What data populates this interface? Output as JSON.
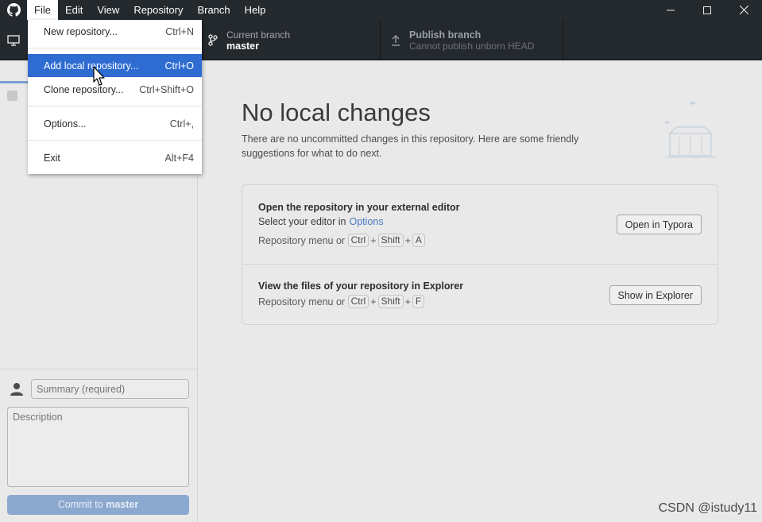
{
  "menubar": {
    "items": [
      "File",
      "Edit",
      "View",
      "Repository",
      "Branch",
      "Help"
    ]
  },
  "toolbar": {
    "current_branch_label": "Current branch",
    "current_branch_value": "master",
    "publish_label": "Publish branch",
    "publish_desc": "Cannot publish unborn HEAD"
  },
  "file_menu": {
    "items": [
      {
        "label": "New repository...",
        "accel": "Ctrl+N"
      },
      {
        "label": "Add local repository...",
        "accel": "Ctrl+O"
      },
      {
        "label": "Clone repository...",
        "accel": "Ctrl+Shift+O"
      },
      {
        "label": "Options...",
        "accel": "Ctrl+,"
      },
      {
        "label": "Exit",
        "accel": "Alt+F4"
      }
    ]
  },
  "commit": {
    "summary_placeholder": "Summary (required)",
    "description_placeholder": "Description",
    "button_prefix": "Commit to ",
    "button_branch": "master"
  },
  "main": {
    "heading": "No local changes",
    "subtext": "There are no uncommitted changes in this repository. Here are some friendly suggestions for what to do next.",
    "editor_card": {
      "title": "Open the repository in your external editor",
      "line1_prefix": "Select your editor in",
      "line1_link": "Options",
      "line2_prefix": "Repository menu or",
      "keys": [
        "Ctrl",
        "Shift",
        "A"
      ],
      "button": "Open in Typora"
    },
    "explorer_card": {
      "title": "View the files of your repository in Explorer",
      "line_prefix": "Repository menu or",
      "keys": [
        "Ctrl",
        "Shift",
        "F"
      ],
      "button": "Show in Explorer"
    }
  },
  "watermark": "CSDN @istudy11",
  "colors": {
    "titlebar": "#24292e",
    "menu_highlight": "#2e6cd1",
    "link": "#4a78c2"
  }
}
